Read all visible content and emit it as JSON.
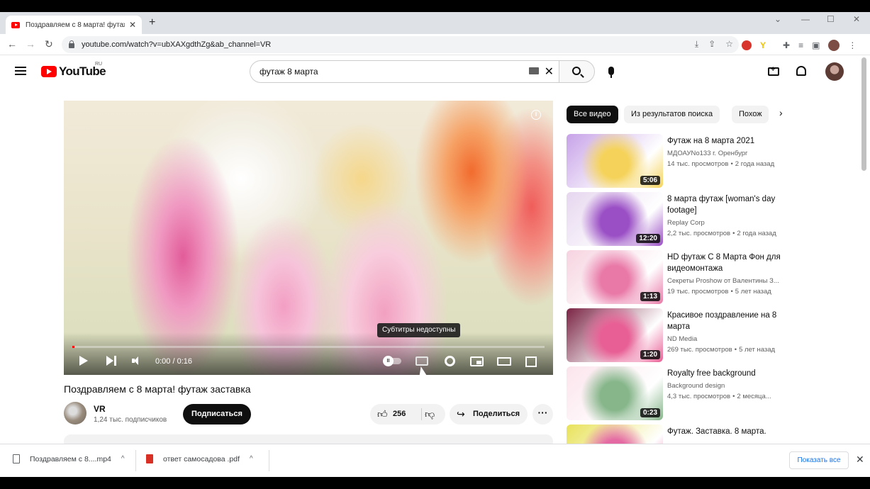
{
  "browser": {
    "tab_title": "Поздравляем с 8 марта! футаж",
    "url": "youtube.com/watch?v=ubXAXgdthZg&ab_channel=VR"
  },
  "youtube": {
    "logo_text": "YouTube",
    "region": "RU",
    "search_value": "футаж 8 марта"
  },
  "player": {
    "time": "0:00 / 0:16",
    "progress_fraction": 0.0,
    "tooltip": "Субтитры недоступны",
    "captions_state": "unavailable"
  },
  "video": {
    "title": "Поздравляем с 8 марта! футаж заставка",
    "channel": "VR",
    "subscribers": "1,24 тыс. подписчиков",
    "subscribe_label": "Подписаться",
    "likes": "256",
    "share_label": "Поделиться"
  },
  "chips": [
    "Все видео",
    "Из результатов поиска",
    "Похож"
  ],
  "recommendations": [
    {
      "title": "Футаж на 8 марта 2021",
      "channel": "МДОАУNo133 г. Оренбург",
      "views": "14 тыс. просмотров",
      "age": "2 года назад",
      "duration": "5:06",
      "colors": [
        "#c7a2e8",
        "#f5d35a"
      ]
    },
    {
      "title": "8 марта футаж [woman's day footage]",
      "channel": "Replay Corp",
      "views": "2,2 тыс. просмотров",
      "age": "2 года назад",
      "duration": "12:20",
      "colors": [
        "#e6d6ef",
        "#9a4fc5"
      ]
    },
    {
      "title": "HD футаж С 8 Марта Фон для видеомонтажа",
      "channel": "Секреты Proshow от Валентины З...",
      "views": "19 тыс. просмотров",
      "age": "5 лет назад",
      "duration": "1:13",
      "colors": [
        "#f6d3e0",
        "#e97aa8"
      ]
    },
    {
      "title": "Красивое поздравление на 8 марта",
      "channel": "ND Media",
      "views": "269 тыс. просмотров",
      "age": "5 лет назад",
      "duration": "1:20",
      "colors": [
        "#7a2444",
        "#e85f95"
      ]
    },
    {
      "title": "Royalty free background",
      "channel": "Background design",
      "views": "4,3 тыс. просмотров",
      "age": "2 месяца...",
      "duration": "0:23",
      "colors": [
        "#fbe4ec",
        "#86b68a"
      ]
    },
    {
      "title": "Футаж. Заставка. 8 марта.",
      "channel": "",
      "views": "",
      "age": "",
      "duration": "",
      "colors": [
        "#e8e25a",
        "#e46aa3"
      ]
    }
  ],
  "downloads": {
    "file1": "Поздравляем с 8....mp4",
    "file2": "ответ самосадова .pdf",
    "show_all": "Показать все"
  },
  "icons": {
    "back": "arrow-left-icon",
    "forward": "arrow-right-icon",
    "reload": "reload-icon",
    "search": "search-icon",
    "mic": "microphone-icon",
    "create": "video-create-icon",
    "notifications": "bell-icon",
    "play": "play-icon",
    "next": "skip-next-icon",
    "volume": "volume-icon",
    "settings": "gear-icon",
    "miniplayer": "miniplayer-icon",
    "theater": "theater-icon",
    "fullscreen": "fullscreen-icon"
  }
}
